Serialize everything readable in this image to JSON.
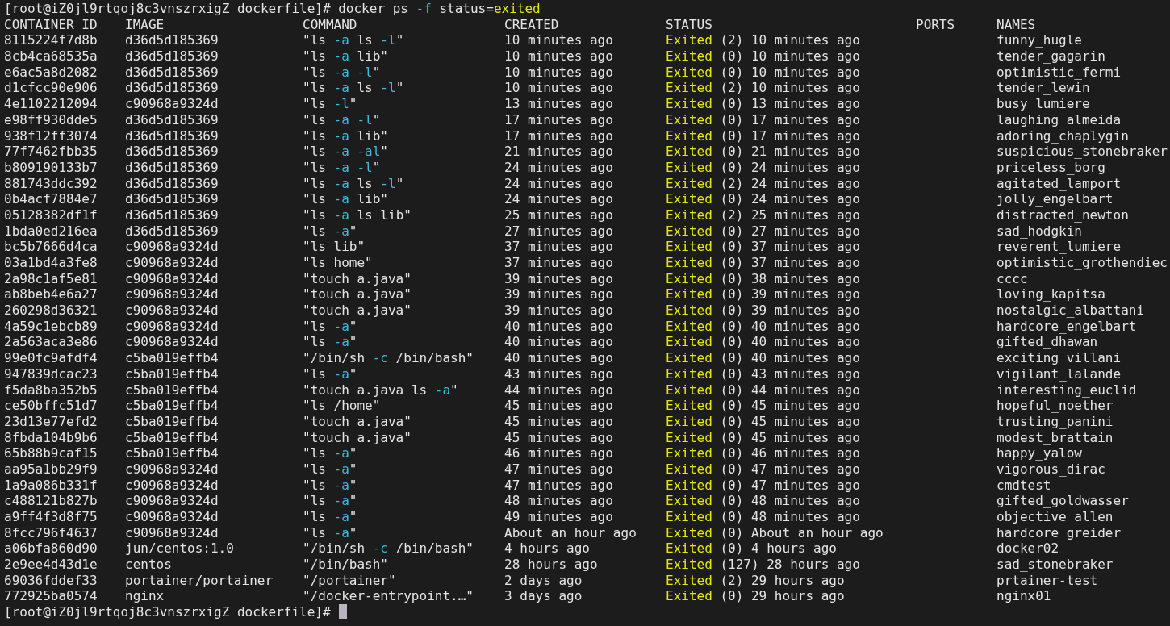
{
  "prompt": {
    "user_host": "[root@iZ0jl9rtqoj8c3vnszrxigZ dockerfile]#",
    "command": [
      {
        "kind": "plain",
        "text": " docker ps "
      },
      {
        "kind": "flag",
        "text": "-f"
      },
      {
        "kind": "plain",
        "text": " status="
      },
      {
        "kind": "value",
        "text": "exited"
      }
    ]
  },
  "columns": [
    "CONTAINER ID",
    "IMAGE",
    "COMMAND",
    "CREATED",
    "STATUS",
    "PORTS",
    "NAMES"
  ],
  "rows": [
    {
      "id": "8115224f7d8b",
      "image": "d36d5d185369",
      "command": "\"ls -a ls -l\"",
      "created": "10 minutes ago",
      "state": "Exited",
      "detail": " (2) 10 minutes ago",
      "name": "funny_hugle"
    },
    {
      "id": "8cb4ca68535a",
      "image": "d36d5d185369",
      "command": "\"ls -a lib\"",
      "created": "10 minutes ago",
      "state": "Exited",
      "detail": " (0) 10 minutes ago",
      "name": "tender_gagarin"
    },
    {
      "id": "e6ac5a8d2082",
      "image": "d36d5d185369",
      "command": "\"ls -a -l\"",
      "created": "10 minutes ago",
      "state": "Exited",
      "detail": " (0) 10 minutes ago",
      "name": "optimistic_fermi"
    },
    {
      "id": "d1cfcc90e906",
      "image": "d36d5d185369",
      "command": "\"ls -a ls -l\"",
      "created": "10 minutes ago",
      "state": "Exited",
      "detail": " (2) 10 minutes ago",
      "name": "tender_lewin"
    },
    {
      "id": "4e1102212094",
      "image": "c90968a9324d",
      "command": "\"ls -l\"",
      "created": "13 minutes ago",
      "state": "Exited",
      "detail": " (0) 13 minutes ago",
      "name": "busy_lumiere"
    },
    {
      "id": "e98ff930dde5",
      "image": "d36d5d185369",
      "command": "\"ls -a -l\"",
      "created": "17 minutes ago",
      "state": "Exited",
      "detail": " (0) 17 minutes ago",
      "name": "laughing_almeida"
    },
    {
      "id": "938f12ff3074",
      "image": "d36d5d185369",
      "command": "\"ls -a lib\"",
      "created": "17 minutes ago",
      "state": "Exited",
      "detail": " (0) 17 minutes ago",
      "name": "adoring_chaplygin"
    },
    {
      "id": "77f7462fbb35",
      "image": "d36d5d185369",
      "command": "\"ls -a -al\"",
      "created": "21 minutes ago",
      "state": "Exited",
      "detail": " (0) 21 minutes ago",
      "name": "suspicious_stonebraker"
    },
    {
      "id": "b809190133b7",
      "image": "d36d5d185369",
      "command": "\"ls -a -l\"",
      "created": "24 minutes ago",
      "state": "Exited",
      "detail": " (0) 24 minutes ago",
      "name": "priceless_borg"
    },
    {
      "id": "881743ddc392",
      "image": "d36d5d185369",
      "command": "\"ls -a ls -l\"",
      "created": "24 minutes ago",
      "state": "Exited",
      "detail": " (2) 24 minutes ago",
      "name": "agitated_lamport"
    },
    {
      "id": "0b4acf7884e7",
      "image": "d36d5d185369",
      "command": "\"ls -a lib\"",
      "created": "24 minutes ago",
      "state": "Exited",
      "detail": " (0) 24 minutes ago",
      "name": "jolly_engelbart"
    },
    {
      "id": "05128382df1f",
      "image": "d36d5d185369",
      "command": "\"ls -a ls lib\"",
      "created": "25 minutes ago",
      "state": "Exited",
      "detail": " (2) 25 minutes ago",
      "name": "distracted_newton"
    },
    {
      "id": "1bda0ed216ea",
      "image": "d36d5d185369",
      "command": "\"ls -a\"",
      "created": "27 minutes ago",
      "state": "Exited",
      "detail": " (0) 27 minutes ago",
      "name": "sad_hodgkin"
    },
    {
      "id": "bc5b7666d4ca",
      "image": "c90968a9324d",
      "command": "\"ls lib\"",
      "created": "37 minutes ago",
      "state": "Exited",
      "detail": " (0) 37 minutes ago",
      "name": "reverent_lumiere"
    },
    {
      "id": "03a1bd4a3fe8",
      "image": "c90968a9324d",
      "command": "\"ls home\"",
      "created": "37 minutes ago",
      "state": "Exited",
      "detail": " (0) 37 minutes ago",
      "name": "optimistic_grothendiec"
    },
    {
      "id": "2a98c1af5e81",
      "image": "c90968a9324d",
      "command": "\"touch a.java\"",
      "created": "39 minutes ago",
      "state": "Exited",
      "detail": " (0) 38 minutes ago",
      "name": "cccc"
    },
    {
      "id": "ab8beb4e6a27",
      "image": "c90968a9324d",
      "command": "\"touch a.java\"",
      "created": "39 minutes ago",
      "state": "Exited",
      "detail": " (0) 39 minutes ago",
      "name": "loving_kapitsa"
    },
    {
      "id": "260298d36321",
      "image": "c90968a9324d",
      "command": "\"touch a.java\"",
      "created": "39 minutes ago",
      "state": "Exited",
      "detail": " (0) 39 minutes ago",
      "name": "nostalgic_albattani"
    },
    {
      "id": "4a59c1ebcb89",
      "image": "c90968a9324d",
      "command": "\"ls -a\"",
      "created": "40 minutes ago",
      "state": "Exited",
      "detail": " (0) 40 minutes ago",
      "name": "hardcore_engelbart"
    },
    {
      "id": "2a563aca3e86",
      "image": "c90968a9324d",
      "command": "\"ls -a\"",
      "created": "40 minutes ago",
      "state": "Exited",
      "detail": " (0) 40 minutes ago",
      "name": "gifted_dhawan"
    },
    {
      "id": "99e0fc9afdf4",
      "image": "c5ba019effb4",
      "command": "\"/bin/sh -c /bin/bash\"",
      "created": "40 minutes ago",
      "state": "Exited",
      "detail": " (0) 40 minutes ago",
      "name": "exciting_villani"
    },
    {
      "id": "947839dcac23",
      "image": "c5ba019effb4",
      "command": "\"ls -a\"",
      "created": "43 minutes ago",
      "state": "Exited",
      "detail": " (0) 43 minutes ago",
      "name": "vigilant_lalande"
    },
    {
      "id": "f5da8ba352b5",
      "image": "c5ba019effb4",
      "command": "\"touch a.java ls -a\"",
      "created": "44 minutes ago",
      "state": "Exited",
      "detail": " (0) 44 minutes ago",
      "name": "interesting_euclid"
    },
    {
      "id": "ce50bffc51d7",
      "image": "c5ba019effb4",
      "command": "\"ls /home\"",
      "created": "45 minutes ago",
      "state": "Exited",
      "detail": " (0) 45 minutes ago",
      "name": "hopeful_noether"
    },
    {
      "id": "23d13e77efd2",
      "image": "c5ba019effb4",
      "command": "\"touch a.java\"",
      "created": "45 minutes ago",
      "state": "Exited",
      "detail": " (0) 45 minutes ago",
      "name": "trusting_panini"
    },
    {
      "id": "8fbda104b9b6",
      "image": "c5ba019effb4",
      "command": "\"touch a.java\"",
      "created": "45 minutes ago",
      "state": "Exited",
      "detail": " (0) 45 minutes ago",
      "name": "modest_brattain"
    },
    {
      "id": "65b88b9caf15",
      "image": "c5ba019effb4",
      "command": "\"ls -a\"",
      "created": "46 minutes ago",
      "state": "Exited",
      "detail": " (0) 46 minutes ago",
      "name": "happy_yalow"
    },
    {
      "id": "aa95a1bb29f9",
      "image": "c90968a9324d",
      "command": "\"ls -a\"",
      "created": "47 minutes ago",
      "state": "Exited",
      "detail": " (0) 47 minutes ago",
      "name": "vigorous_dirac"
    },
    {
      "id": "1a9a086b331f",
      "image": "c90968a9324d",
      "command": "\"ls -a\"",
      "created": "47 minutes ago",
      "state": "Exited",
      "detail": " (0) 47 minutes ago",
      "name": "cmdtest"
    },
    {
      "id": "c488121b827b",
      "image": "c90968a9324d",
      "command": "\"ls -a\"",
      "created": "48 minutes ago",
      "state": "Exited",
      "detail": " (0) 48 minutes ago",
      "name": "gifted_goldwasser"
    },
    {
      "id": "a9ff4f3d8f75",
      "image": "c90968a9324d",
      "command": "\"ls -a\"",
      "created": "49 minutes ago",
      "state": "Exited",
      "detail": " (0) 48 minutes ago",
      "name": "objective_allen"
    },
    {
      "id": "8fcc796f4637",
      "image": "c90968a9324d",
      "command": "\"ls -a\"",
      "created": "About an hour ago",
      "state": "Exited",
      "detail": " (0) About an hour ago",
      "name": "hardcore_greider"
    },
    {
      "id": "a06bfa860d90",
      "image": "jun/centos:1.0",
      "command": "\"/bin/sh -c /bin/bash\"",
      "created": "4 hours ago",
      "state": "Exited",
      "detail": " (0) 4 hours ago",
      "name": "docker02"
    },
    {
      "id": "2e9ee4d43d1e",
      "image": "centos",
      "command": "\"/bin/bash\"",
      "created": "28 hours ago",
      "state": "Exited",
      "detail": " (127) 28 hours ago",
      "name": "sad_stonebraker"
    },
    {
      "id": "69036fddef33",
      "image": "portainer/portainer",
      "command": "\"/portainer\"",
      "created": "2 days ago",
      "state": "Exited",
      "detail": " (2) 29 hours ago",
      "name": "prtainer-test"
    },
    {
      "id": "772925ba0574",
      "image": "nginx",
      "command": "\"/docker-entrypoint.…\"",
      "created": "3 days ago",
      "state": "Exited",
      "detail": " (0) 29 hours ago",
      "name": "nginx01"
    }
  ],
  "final_prompt": {
    "user_host": "[root@iZ0jl9rtqoj8c3vnszrxigZ dockerfile]#",
    "cursor": true
  }
}
